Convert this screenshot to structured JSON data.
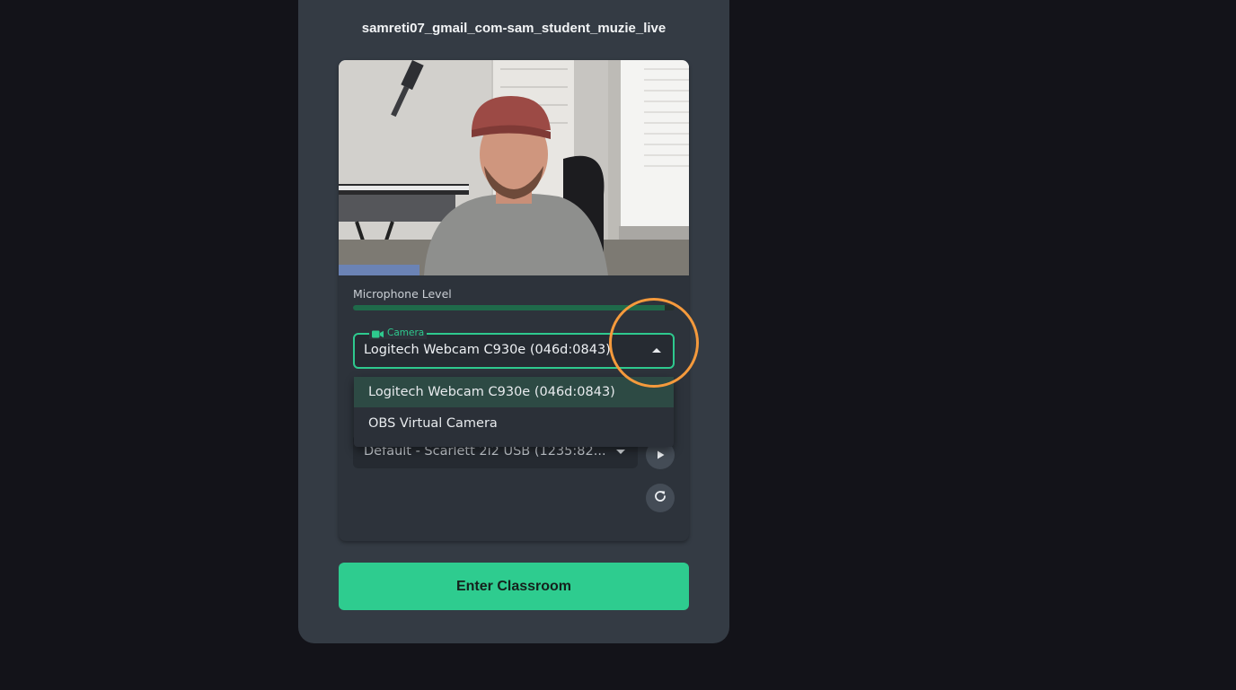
{
  "session": {
    "username": "samreti07_gmail_com-sam_student_muzie_live"
  },
  "preview": {
    "microphone_label": "Microphone Level",
    "microphone_level": 0.97
  },
  "camera_select": {
    "label": "Camera",
    "value": "Logitech Webcam C930e (046d:0843)",
    "options": [
      "Logitech Webcam C930e (046d:0843)",
      "OBS Virtual Camera"
    ]
  },
  "audio_select": {
    "value": "Default - Scarlett 2i2 USB (1235:82..."
  },
  "actions": {
    "enter_label": "Enter Classroom"
  },
  "colors": {
    "accent": "#2ecc8f",
    "panel": "#343b44",
    "background": "#131319",
    "highlight": "#f59a3c"
  },
  "icons": {
    "camera": "camera-icon",
    "play": "play-icon",
    "refresh": "refresh-icon",
    "dropdown_open": "caret-up-icon",
    "dropdown_closed": "caret-down-icon"
  }
}
